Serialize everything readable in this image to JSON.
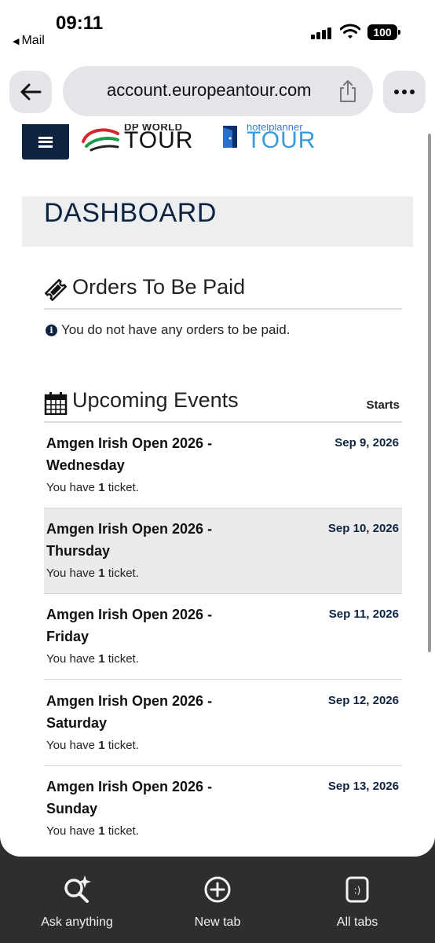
{
  "status_bar": {
    "time": "09:11",
    "back_app": "Mail",
    "battery": "100"
  },
  "browser": {
    "url": "account.europeantour.com"
  },
  "logos": {
    "dp_small": "DP WORLD",
    "dp_tour": "TOUR",
    "hp_small": "hotelplanner",
    "hp_tour": "TOUR"
  },
  "dashboard": {
    "title": "DASHBOARD"
  },
  "orders": {
    "title": "Orders To Be Paid",
    "message": "You do not have any orders to be paid."
  },
  "upcoming": {
    "title": "Upcoming Events",
    "starts_label": "Starts",
    "events": [
      {
        "name": "Amgen Irish Open 2026 - Wednesday",
        "date": "Sep 9, 2026",
        "tickets_prefix": "You have",
        "tickets_count": "1",
        "tickets_suffix": "ticket."
      },
      {
        "name": "Amgen Irish Open 2026 - Thursday",
        "date": "Sep 10, 2026",
        "tickets_prefix": "You have",
        "tickets_count": "1",
        "tickets_suffix": "ticket."
      },
      {
        "name": "Amgen Irish Open 2026 - Friday",
        "date": "Sep 11, 2026",
        "tickets_prefix": "You have",
        "tickets_count": "1",
        "tickets_suffix": "ticket."
      },
      {
        "name": "Amgen Irish Open 2026 - Saturday",
        "date": "Sep 12, 2026",
        "tickets_prefix": "You have",
        "tickets_count": "1",
        "tickets_suffix": "ticket."
      },
      {
        "name": "Amgen Irish Open 2026 - Sunday",
        "date": "Sep 13, 2026",
        "tickets_prefix": "You have",
        "tickets_count": "1",
        "tickets_suffix": "ticket."
      }
    ]
  },
  "bottom_bar": {
    "ask_label": "Ask anything",
    "new_tab_label": "New tab",
    "all_tabs_label": "All tabs"
  },
  "colors": {
    "navy": "#0e2340",
    "highlight_row": "#ebebec",
    "pill_bg": "#e3e5e8"
  }
}
